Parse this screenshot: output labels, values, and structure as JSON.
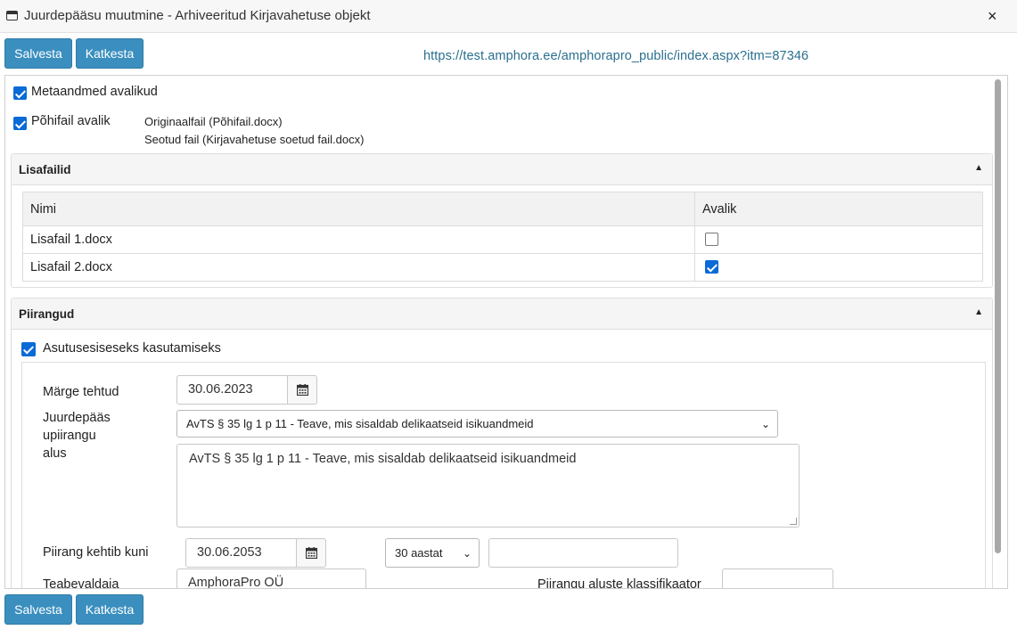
{
  "window": {
    "title": "Juurdepääsu muutmine - Arhiveeritud Kirjavahetuse objekt",
    "icon": "window-icon",
    "close_icon": "×"
  },
  "toolbar": {
    "save_label": "Salvesta",
    "cancel_label": "Katkesta",
    "url": "https://test.amphora.ee/amphorapro_public/index.aspx?itm=87346"
  },
  "general": {
    "metadata_public_label": "Metaandmed avalikud",
    "metadata_public_checked": true,
    "mainfile_public_label": "Põhifail avalik",
    "mainfile_public_checked": true,
    "original_file": "Originaalfail (Põhifail.docx)",
    "linked_file": "Seotud fail (Kirjavahetuse soetud fail.docx)"
  },
  "lisafailid": {
    "title": "Lisafailid",
    "columns": [
      "Nimi",
      "Avalik"
    ],
    "rows": [
      {
        "name": "Lisafail 1.docx",
        "public": false
      },
      {
        "name": "Lisafail 2.docx",
        "public": true
      }
    ]
  },
  "piirangud": {
    "title": "Piirangud",
    "internal_use_label": "Asutusesiseseks kasutamiseks",
    "internal_use_checked": true,
    "marge_label": "Märge tehtud",
    "marge_value": "30.06.2023",
    "basis_label_1": "Juurdepääs",
    "basis_label_2": "upiirangu",
    "basis_label_3": "alus",
    "basis_select_value": "AvTS § 35 lg 1 p 11 - Teave, mis sisaldab delikaatseid isikuandmeid",
    "basis_text_value": "AvTS § 35 lg 1 p 11 - Teave, mis sisaldab delikaatseid isikuandmeid",
    "valid_until_label": "Piirang kehtib kuni",
    "valid_until_value": "30.06.2053",
    "period_select_value": "30 aastat",
    "period_extra_value": "",
    "owner_label": "Teabevaldaja",
    "owner_value": "AmphoraPro OÜ",
    "classifier_label": "Piirangu aluste klassifikaator",
    "classifier_value": ""
  },
  "colors": {
    "button": "#3b8fbf",
    "checkbox": "#0a6ad6",
    "url": "#2a6f8e"
  }
}
